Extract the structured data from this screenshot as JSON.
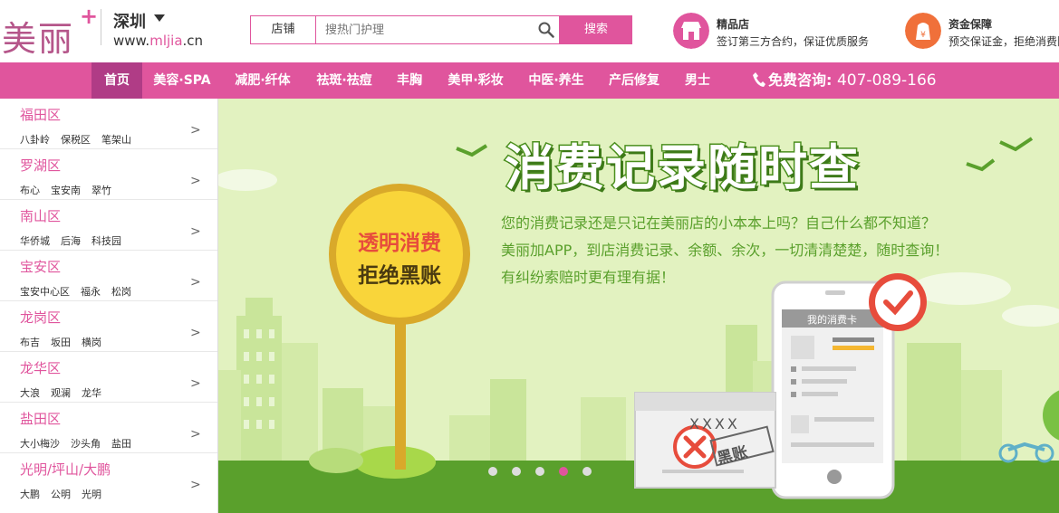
{
  "header": {
    "logo_text": "美丽",
    "logo_plus": "+",
    "city": "深圳",
    "site_url_prefix": "www.",
    "site_url_highlight": "mljia",
    "site_url_suffix": ".cn"
  },
  "search": {
    "type_label": "店铺",
    "placeholder": "搜热门护理",
    "button_label": "搜索"
  },
  "promos": [
    {
      "title": "精品店",
      "desc": "签订第三方合约，保证优质服务",
      "icon": "store-icon",
      "color": "#e0559d"
    },
    {
      "title": "资金保障",
      "desc": "预交保证金，拒绝消费陷阱",
      "icon": "money-bag-icon",
      "color": "#f0703a"
    }
  ],
  "nav": {
    "items": [
      "首页",
      "美容·SPA",
      "减肥·纤体",
      "祛斑·祛痘",
      "丰胸",
      "美甲·彩妆",
      "中医·养生",
      "产后修复",
      "男士"
    ],
    "hotline_label": "免费咨询:",
    "hotline_number": "407-089-166"
  },
  "districts": [
    {
      "name": "福田区",
      "subs": [
        "八卦岭",
        "保税区",
        "笔架山"
      ]
    },
    {
      "name": "罗湖区",
      "subs": [
        "布心",
        "宝安南",
        "翠竹"
      ]
    },
    {
      "name": "南山区",
      "subs": [
        "华侨城",
        "后海",
        "科技园"
      ]
    },
    {
      "name": "宝安区",
      "subs": [
        "宝安中心区",
        "福永",
        "松岗"
      ]
    },
    {
      "name": "龙岗区",
      "subs": [
        "布吉",
        "坂田",
        "横岗"
      ]
    },
    {
      "name": "龙华区",
      "subs": [
        "大浪",
        "观澜",
        "龙华"
      ]
    },
    {
      "name": "盐田区",
      "subs": [
        "大小梅沙",
        "沙头角",
        "盐田"
      ]
    },
    {
      "name": "光明/坪山/大鹏",
      "subs": [
        "大鹏",
        "公明",
        "光明"
      ]
    }
  ],
  "district_arrow": ">",
  "banner": {
    "title": "消费记录随时查",
    "line1": "您的消费记录还是只记在美丽店的小本本上吗？自己什么都不知道？",
    "line2": "美丽加APP，到店消费记录、余额、余次，一切清清楚楚，随时查询！",
    "line3": "有纠纷索赔时更有理有据！",
    "sign_line1": "透明消费",
    "sign_line2": "拒绝黑账",
    "phone_card_title": "我的消费卡",
    "paper_text": "XXXX",
    "stamp_text": "黑账",
    "slide_count": 5,
    "active_slide": 3,
    "colors": {
      "bg": "#e2f2c0",
      "grass": "#5aa02c",
      "sign": "#f9d53a"
    }
  },
  "colors": {
    "accent": "#e0559d",
    "nav_active": "#b03c86"
  }
}
